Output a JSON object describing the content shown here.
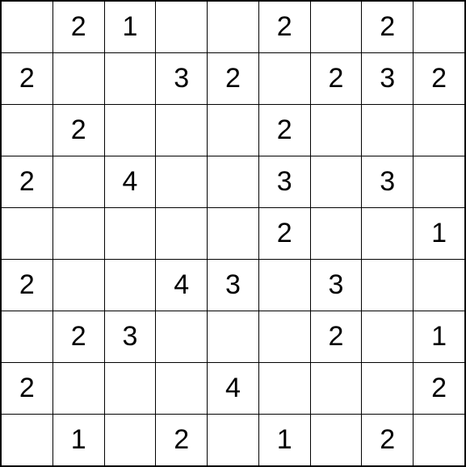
{
  "chart_data": {
    "type": "table",
    "title": "",
    "rows": 9,
    "cols": 9,
    "grid": [
      [
        "",
        "2",
        "1",
        "",
        "",
        "2",
        "",
        "2",
        ""
      ],
      [
        "2",
        "",
        "",
        "3",
        "2",
        "",
        "2",
        "3",
        "2"
      ],
      [
        "",
        "2",
        "",
        "",
        "",
        "2",
        "",
        "",
        ""
      ],
      [
        "2",
        "",
        "4",
        "",
        "",
        "3",
        "",
        "3",
        ""
      ],
      [
        "",
        "",
        "",
        "",
        "",
        "2",
        "",
        "",
        "1"
      ],
      [
        "2",
        "",
        "",
        "4",
        "3",
        "",
        "3",
        "",
        ""
      ],
      [
        "",
        "2",
        "3",
        "",
        "",
        "",
        "2",
        "",
        "1"
      ],
      [
        "2",
        "",
        "",
        "",
        "4",
        "",
        "",
        "",
        "2"
      ],
      [
        "",
        "1",
        "",
        "2",
        "",
        "1",
        "",
        "2",
        ""
      ]
    ]
  }
}
